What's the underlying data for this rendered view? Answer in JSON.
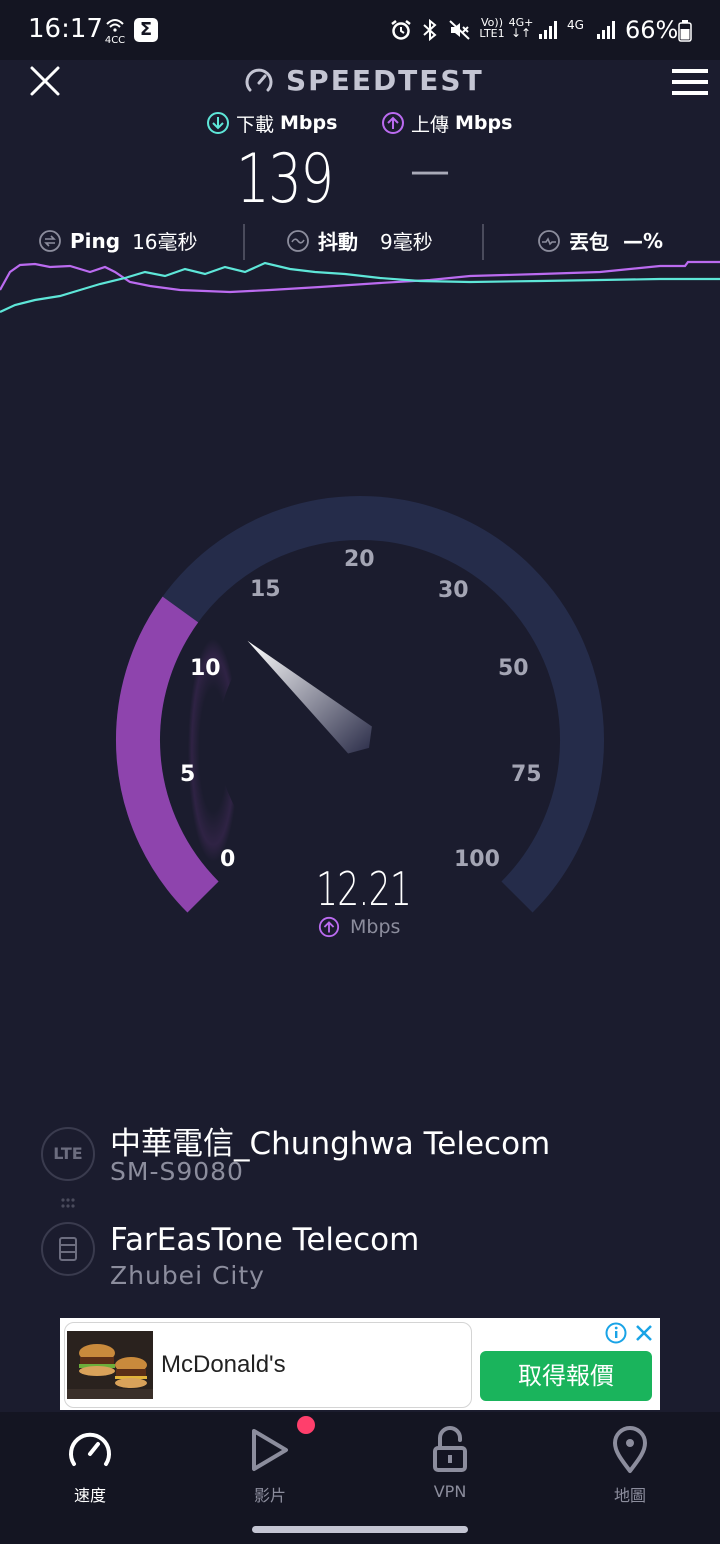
{
  "status_bar": {
    "time": "16:17",
    "net_label": "4CC",
    "volte_top": "Vo))",
    "volte_bottom": "LTE1",
    "net_4g_plus": "4G+",
    "net_4g": "4G",
    "battery": "66%"
  },
  "header": {
    "title": "SPEEDTEST"
  },
  "metrics": {
    "download_label": "下載",
    "download_unit": "Mbps",
    "upload_label": "上傳",
    "upload_unit": "Mbps",
    "download_value": "139",
    "upload_value": "—"
  },
  "stats": {
    "ping_label": "Ping",
    "ping_value": "16毫秒",
    "jitter_label": "抖動",
    "jitter_value": "9毫秒",
    "loss_label": "丟包",
    "loss_value": "—%"
  },
  "gauge": {
    "ticks": [
      "0",
      "5",
      "10",
      "15",
      "20",
      "30",
      "50",
      "75",
      "100"
    ],
    "current_value": "12.21",
    "unit": "Mbps",
    "fill_fraction": 0.3,
    "colors": {
      "fill": "#8e44ad",
      "track": "#252c4a",
      "needle": "#ffffff"
    }
  },
  "connection": {
    "provider": "中華電信_Chunghwa Telecom",
    "device": "SM-S9080",
    "tech_badge": "LTE",
    "server": "FarEasTone Telecom",
    "server_location": "Zhubei City"
  },
  "ad": {
    "brand": "McDonald's",
    "cta": "取得報價"
  },
  "bottom_nav": {
    "items": [
      {
        "label": "速度",
        "icon": "speed-gauge-icon",
        "active": true
      },
      {
        "label": "影片",
        "icon": "play-icon",
        "active": false
      },
      {
        "label": "VPN",
        "icon": "lock-open-icon",
        "active": false
      },
      {
        "label": "地圖",
        "icon": "map-pin-icon",
        "active": false
      }
    ]
  },
  "colors": {
    "background": "#1b1c2e",
    "download": "#5ee6d8",
    "upload": "#bb6bf0"
  }
}
